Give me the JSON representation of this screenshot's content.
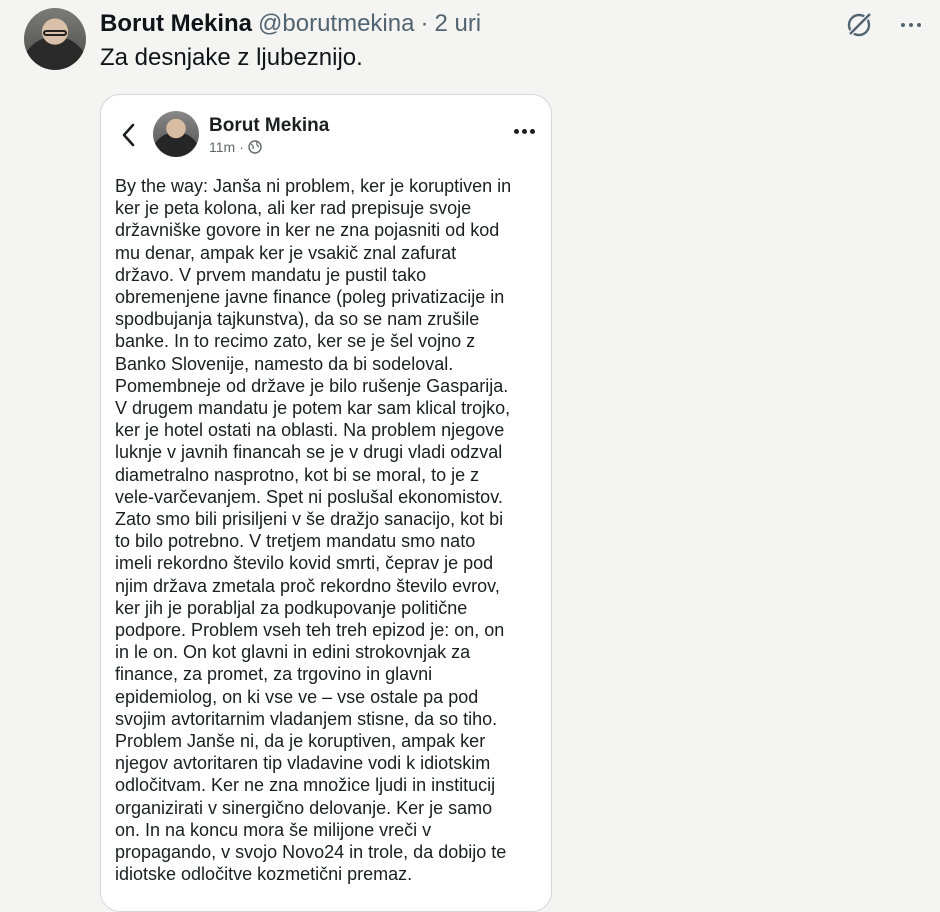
{
  "tweet": {
    "author_name": "Borut Mekina",
    "handle": "@borutmekina",
    "separator": "·",
    "time": "2 uri",
    "text": "Za desnjake z ljubeznijo."
  },
  "icons": {
    "grok": "grok-icon",
    "more": "more-dots-icon",
    "back": "chevron-left-icon",
    "globe": "globe-icon"
  },
  "media": {
    "post_author": "Borut Mekina",
    "post_time": "11m",
    "post_sep": "·",
    "lines": [
      "By the way: Janša ni problem, ker je koruptiven in",
      "ker je peta kolona, ali ker rad prepisuje svoje",
      "državniške govore in ker ne zna pojasniti od kod",
      "mu denar, ampak ker je vsakič znal zafurat",
      "državo. V prvem mandatu je pustil tako",
      "obremenjene javne finance (poleg privatizacije in",
      "spodbujanja tajkunstva), da so se nam zrušile",
      "banke. In to recimo zato,  ker se je šel vojno z",
      "Banko Slovenije, namesto da bi sodeloval.",
      "Pomembneje od države je bilo rušenje Gasparija.",
      "V drugem mandatu je potem kar sam klical trojko,",
      "ker je hotel ostati na oblasti. Na problem njegove",
      "luknje v javnih financah se je v drugi vladi odzval",
      "diametralno nasprotno, kot bi se moral, to je z",
      "vele-varčevanjem. Spet ni poslušal ekonomistov.",
      "Zato smo bili prisiljeni v še dražjo sanacijo, kot bi",
      "to bilo potrebno. V tretjem mandatu smo nato",
      "imeli rekordno število kovid smrti, čeprav je pod",
      "njim država zmetala proč rekordno število evrov,",
      "ker jih je porabljal za podkupovanje politične",
      "podpore. Problem vseh teh treh epizod je: on, on",
      "in le on. On kot glavni in edini strokovnjak za",
      "finance, za promet, za trgovino in glavni",
      "epidemiolog, on ki vse ve – vse ostale pa pod",
      "svojim avtoritarnim vladanjem stisne, da so tiho.",
      "Problem Janše ni, da je koruptiven, ampak ker",
      "njegov avtoritaren tip vladavine vodi k idiotskim",
      "odločitvam. Ker ne zna množice ljudi in institucij",
      "organizirati v sinergično delovanje. Ker je samo",
      "on. In na koncu mora še milijone vreči v",
      "propagando, v svojo Novo24 in trole, da dobijo te",
      "idiotske odločitve kozmetični premaz."
    ]
  }
}
